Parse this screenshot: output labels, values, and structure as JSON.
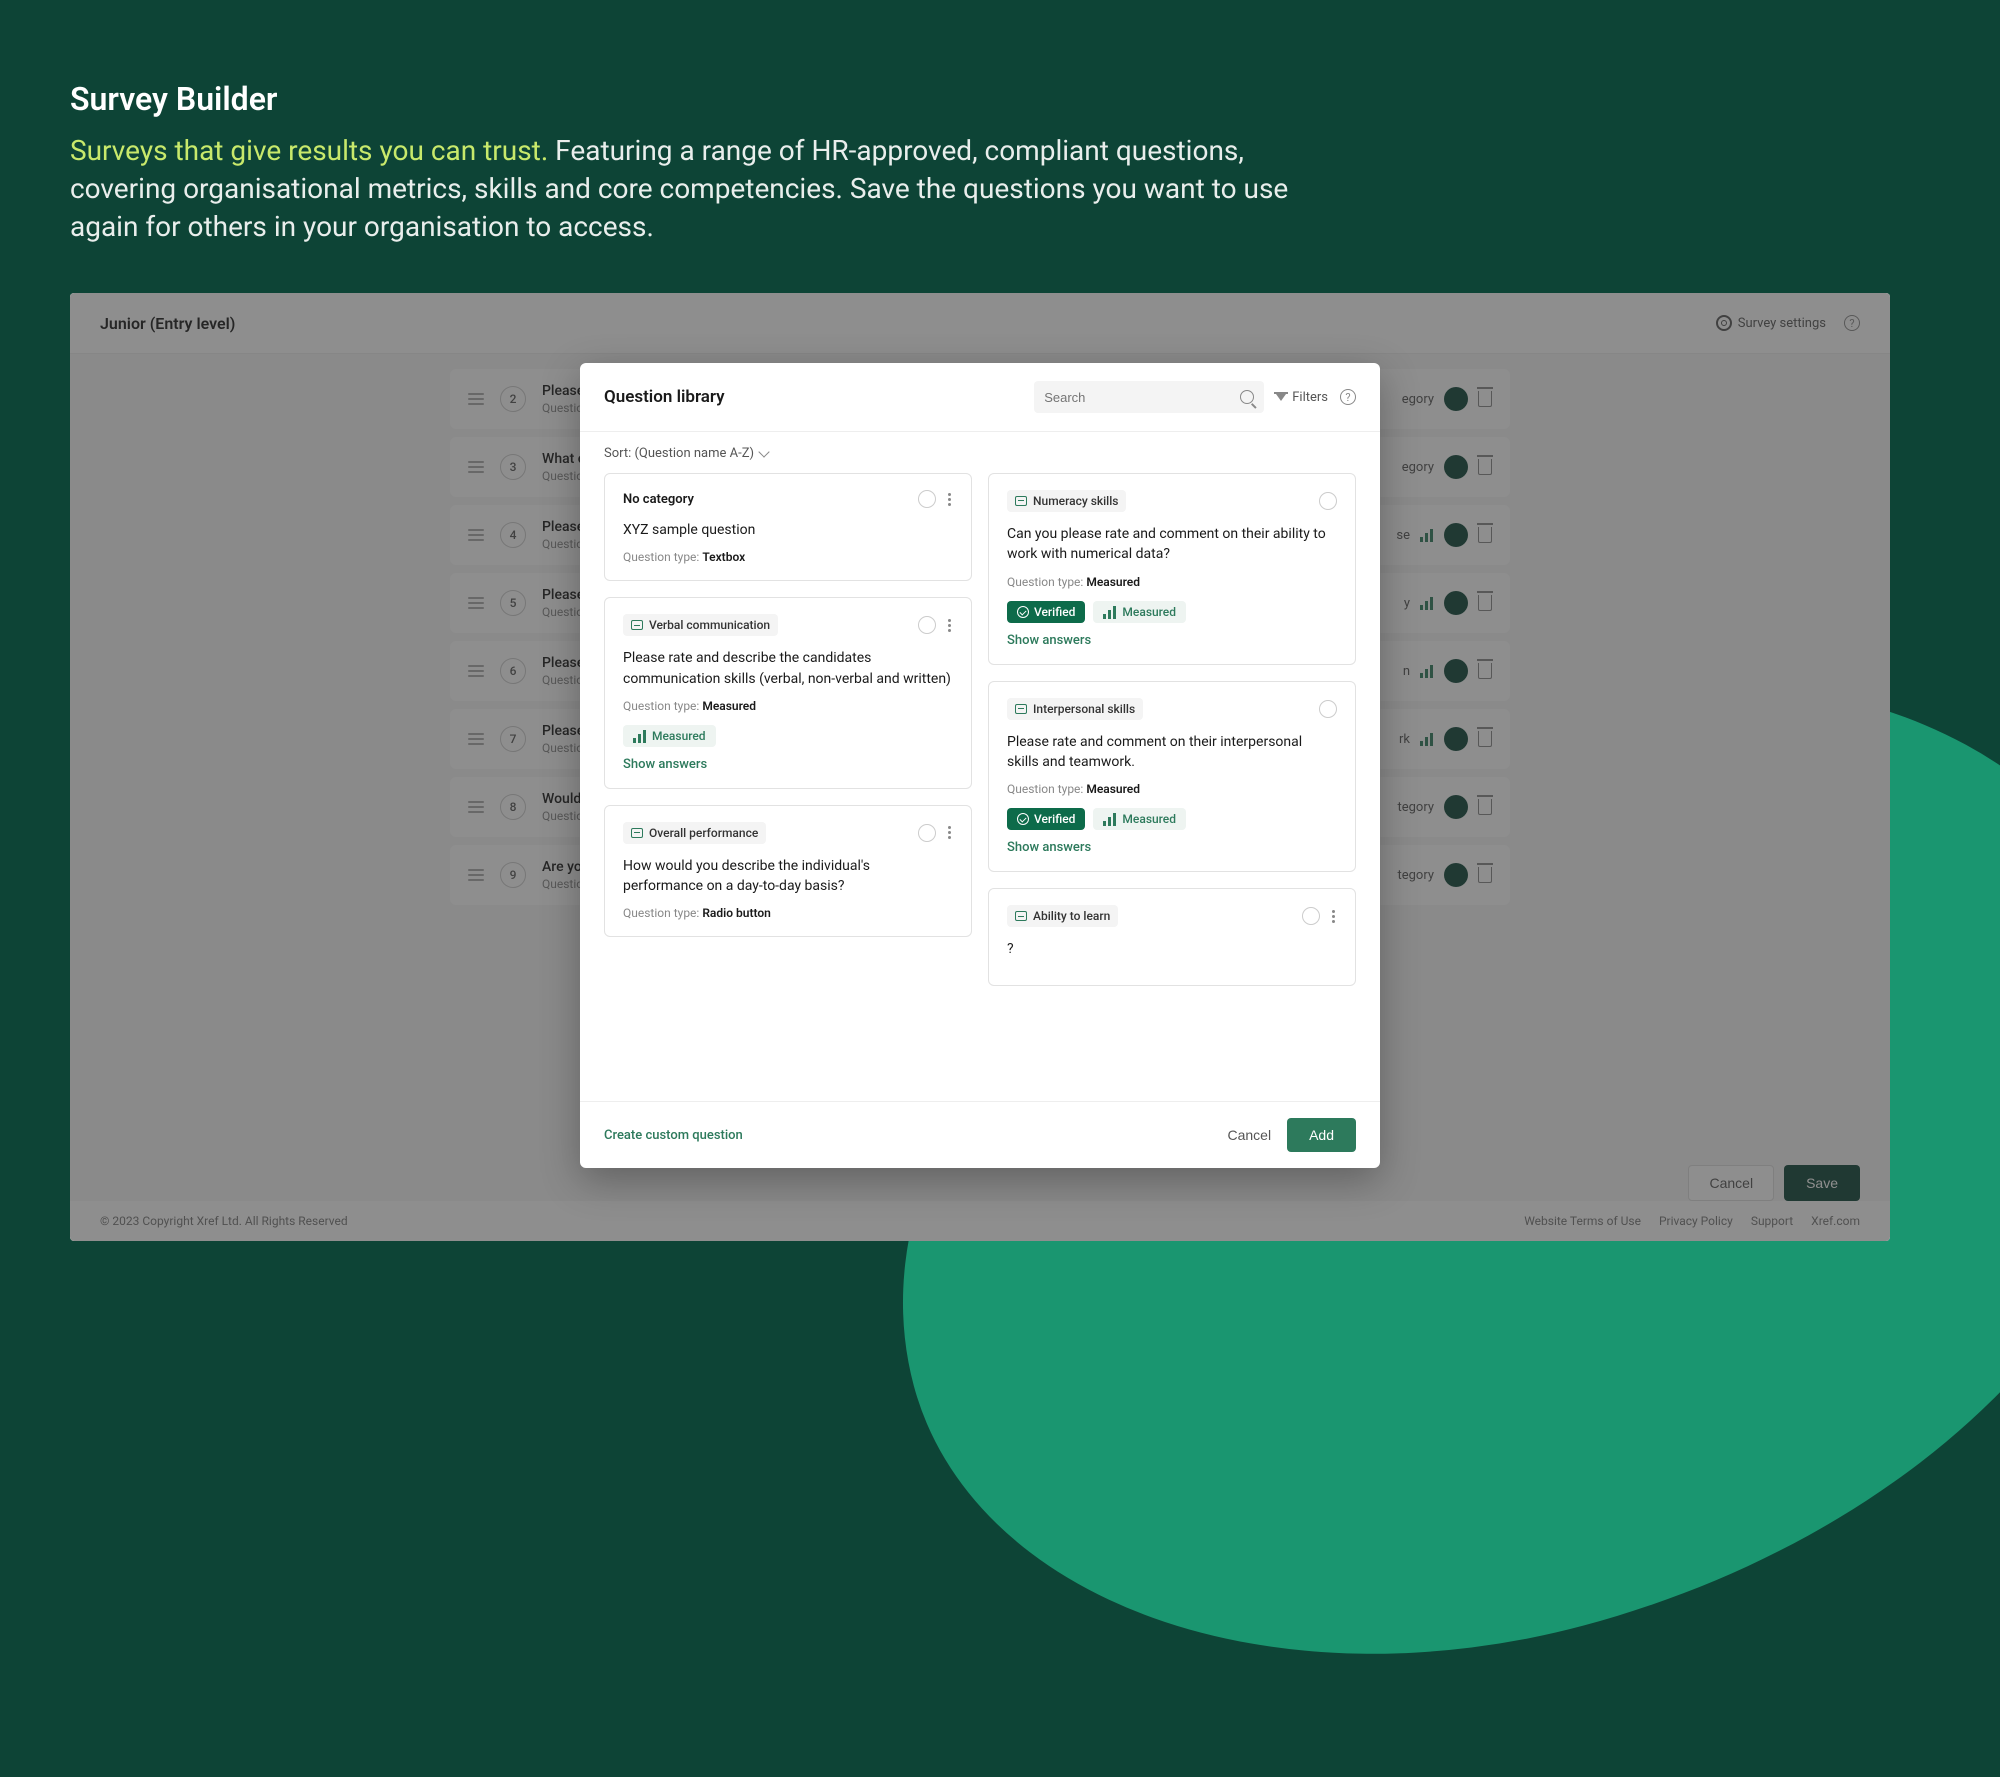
{
  "hero": {
    "title": "Survey Builder",
    "accent": "Surveys that give results you can trust. ",
    "body": "Featuring a range of HR-approved, compliant questions, covering organisational metrics, skills and core competencies. Save the questions you want to use again for others in your organisation to access."
  },
  "app": {
    "title": "Junior (Entry level)",
    "settings_label": "Survey settings",
    "footer_copy": "© 2023 Copyright Xref Ltd. All Rights Reserved",
    "footer_links": [
      "Website Terms of Use",
      "Privacy Policy",
      "Support",
      "Xref.com"
    ],
    "bottom_cancel": "Cancel",
    "bottom_save": "Save"
  },
  "rows": [
    {
      "n": "2",
      "title": "Please",
      "sub": "Question",
      "right": "egory",
      "bars": false
    },
    {
      "n": "3",
      "title": "What o attribu",
      "sub": "Question",
      "right": "egory",
      "bars": false
    },
    {
      "n": "4",
      "title": "Please",
      "sub": "Question",
      "right": "se",
      "bars": true
    },
    {
      "n": "5",
      "title": "Please",
      "sub": "Question",
      "right": "y",
      "bars": true
    },
    {
      "n": "6",
      "title": "Please",
      "sub": "Question",
      "right": "n",
      "bars": true
    },
    {
      "n": "7",
      "title": "Please",
      "sub": "Question",
      "right": "rk",
      "bars": true
    },
    {
      "n": "8",
      "title": "Would",
      "sub": "Question",
      "right": "tegory",
      "bars": false
    },
    {
      "n": "9",
      "title": "Are you day an",
      "sub": "Question",
      "right": "tegory",
      "bars": false
    }
  ],
  "modal": {
    "title": "Question library",
    "search_placeholder": "Search",
    "filters_label": "Filters",
    "sort_label": "Sort: (Question name A-Z)",
    "create_link": "Create custom question",
    "cancel": "Cancel",
    "add": "Add",
    "show_answers": "Show answers"
  },
  "cards_left": [
    {
      "no_category": true,
      "category": "No category",
      "text": "XYZ sample question",
      "type": "Textbox",
      "verified": false,
      "measured_badge": false,
      "has_answers": false,
      "more": true
    },
    {
      "no_category": false,
      "category": "Verbal communication",
      "text": "Please rate and describe the candidates communication skills (verbal, non-verbal and written)",
      "type": "Measured",
      "verified": false,
      "measured_badge": true,
      "has_answers": true,
      "more": true
    },
    {
      "no_category": false,
      "category": "Overall performance",
      "text": "How would you describe the individual's performance on a day-to-day basis?",
      "type": "Radio button",
      "verified": false,
      "measured_badge": false,
      "has_answers": false,
      "more": true
    }
  ],
  "cards_right": [
    {
      "no_category": false,
      "category": "Numeracy skills",
      "text": "Can you please rate and comment on their ability to work with numerical data?",
      "type": "Measured",
      "verified": true,
      "measured_badge": true,
      "has_answers": true,
      "more": false
    },
    {
      "no_category": false,
      "category": "Interpersonal skills",
      "text": "Please rate and comment on their interpersonal skills and teamwork.",
      "type": "Measured",
      "verified": true,
      "measured_badge": true,
      "has_answers": true,
      "more": false
    },
    {
      "no_category": false,
      "category": "Ability to learn",
      "text": "?",
      "type": "",
      "verified": false,
      "measured_badge": false,
      "has_answers": false,
      "more": true
    }
  ],
  "labels": {
    "question_type": "Question type:",
    "verified": "Verified",
    "measured": "Measured"
  }
}
